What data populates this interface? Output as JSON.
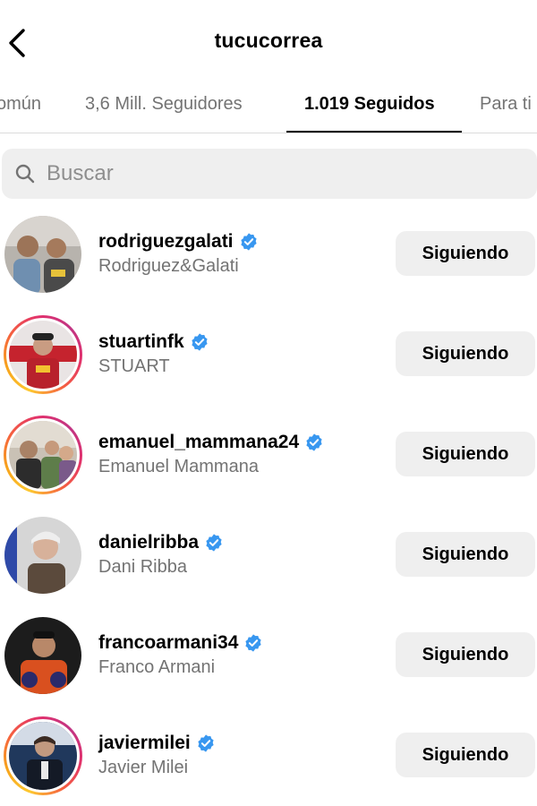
{
  "header": {
    "title": "tucucorrea",
    "back_icon": "chevron-left-icon"
  },
  "tabs": [
    {
      "label": "omún",
      "active": false
    },
    {
      "label": "3,6 Mill. Seguidores",
      "active": false
    },
    {
      "label": "1.019 Seguidos",
      "active": true
    },
    {
      "label": "Para ti",
      "active": false
    }
  ],
  "search": {
    "placeholder": "Buscar",
    "value": "",
    "icon": "search-icon"
  },
  "accounts": [
    {
      "username": "rodriguezgalati",
      "full_name": "Rodriguez&Galati",
      "verified": true,
      "story_ring": false,
      "button": "Siguiendo"
    },
    {
      "username": "stuartinfk",
      "full_name": "STUART",
      "verified": true,
      "story_ring": true,
      "button": "Siguiendo"
    },
    {
      "username": "emanuel_mammana24",
      "full_name": "Emanuel Mammana",
      "verified": true,
      "story_ring": true,
      "button": "Siguiendo"
    },
    {
      "username": "danielribba",
      "full_name": "Dani Ribba",
      "verified": true,
      "story_ring": false,
      "button": "Siguiendo"
    },
    {
      "username": "francoarmani34",
      "full_name": "Franco Armani",
      "verified": true,
      "story_ring": false,
      "button": "Siguiendo"
    },
    {
      "username": "javiermilei",
      "full_name": "Javier Milei",
      "verified": true,
      "story_ring": true,
      "button": "Siguiendo"
    }
  ],
  "colors": {
    "verified_blue": "#3897f0",
    "secondary_text": "#737373",
    "button_bg": "#efefef"
  }
}
